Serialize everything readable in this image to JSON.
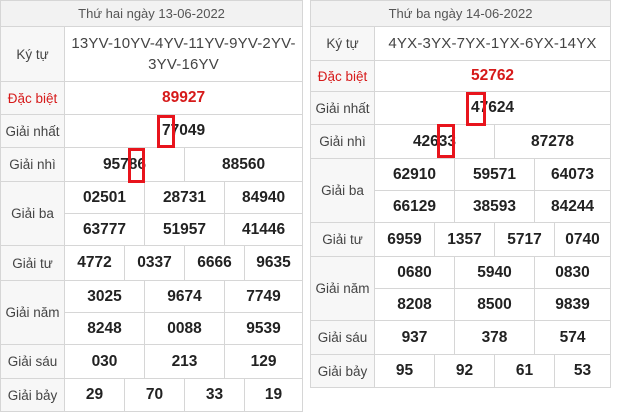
{
  "left": {
    "header": "Thứ hai ngày 13-06-2022",
    "labels": {
      "code": "Ký tự",
      "special": "Đặc biệt",
      "first": "Giải nhất",
      "second": "Giải nhì",
      "third": "Giải ba",
      "fourth": "Giải tư",
      "fifth": "Giải năm",
      "sixth": "Giải sáu",
      "seventh": "Giải bảy"
    },
    "code": "13YV-10YV-4YV-11YV-9YV-2YV-3YV-16YV",
    "special": "89927",
    "first": "77049",
    "second": [
      "95786",
      "88560"
    ],
    "third": [
      "02501",
      "28731",
      "84940",
      "63777",
      "51957",
      "41446"
    ],
    "fourth": [
      "4772",
      "0337",
      "6666",
      "9635"
    ],
    "fifth": [
      "3025",
      "9674",
      "7749",
      "8248",
      "0088",
      "9539"
    ],
    "sixth": [
      "030",
      "213",
      "129"
    ],
    "seventh": [
      "29",
      "70",
      "33",
      "19"
    ]
  },
  "right": {
    "header": "Thứ ba ngày 14-06-2022",
    "labels": {
      "code": "Ký tự",
      "special": "Đặc biệt",
      "first": "Giải nhất",
      "second": "Giải nhì",
      "third": "Giải ba",
      "fourth": "Giải tư",
      "fifth": "Giải năm",
      "sixth": "Giải sáu",
      "seventh": "Giải bảy"
    },
    "code": "4YX-3YX-7YX-1YX-6YX-14YX",
    "special": "52762",
    "first": "47624",
    "second": [
      "42633",
      "87278"
    ],
    "third": [
      "62910",
      "59571",
      "64073",
      "66129",
      "38593",
      "84244"
    ],
    "fourth": [
      "6959",
      "1357",
      "5717",
      "0740"
    ],
    "fifth": [
      "0680",
      "5940",
      "0830",
      "8208",
      "8500",
      "9839"
    ],
    "sixth": [
      "937",
      "378",
      "574"
    ],
    "seventh": [
      "95",
      "92",
      "61",
      "53"
    ]
  },
  "colors": {
    "accent_red": "#d61a1a",
    "highlight_box": "#e8141c"
  }
}
